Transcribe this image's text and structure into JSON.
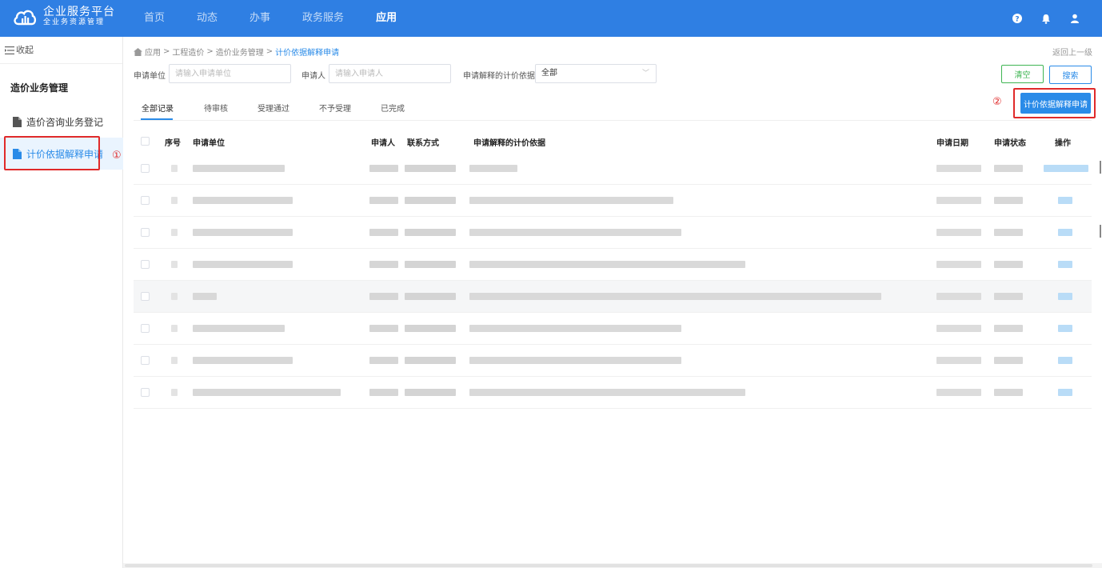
{
  "header": {
    "brand_title": "企业服务平台",
    "brand_subtitle": "全业务资源管理",
    "nav": [
      {
        "label": "首页",
        "active": false
      },
      {
        "label": "动态",
        "active": false
      },
      {
        "label": "办事",
        "active": false
      },
      {
        "label": "政务服务",
        "active": false
      },
      {
        "label": "应用",
        "active": true
      }
    ],
    "icons": [
      "help-icon",
      "bell-icon",
      "user-icon"
    ],
    "color": "#2f7fe3"
  },
  "sidebar": {
    "collapse_label": "收起",
    "section_title": "造价业务管理",
    "items": [
      {
        "label": "造价咨询业务登记",
        "active": false
      },
      {
        "label": "计价依据解释申请",
        "active": true
      }
    ],
    "annotation": "①"
  },
  "breadcrumb": {
    "items": [
      "应用",
      "工程造价",
      "造价业务管理",
      "计价依据解释申请"
    ],
    "separator": ">",
    "back_label": "返回上一级"
  },
  "filters": {
    "unit_label": "申请单位",
    "unit_placeholder": "请输入申请单位",
    "applicant_label": "申请人",
    "applicant_placeholder": "请输入申请人",
    "basis_label": "申请解释的计价依据",
    "basis_value": "全部",
    "clear_label": "清空",
    "search_label": "搜索"
  },
  "tabs": [
    {
      "label": "全部记录",
      "active": true
    },
    {
      "label": "待审核",
      "active": false
    },
    {
      "label": "受理通过",
      "active": false
    },
    {
      "label": "不予受理",
      "active": false
    },
    {
      "label": "已完成",
      "active": false
    }
  ],
  "actions": {
    "apply_label": "计价依据解释申请",
    "annotation": "②"
  },
  "table": {
    "columns": [
      "序号",
      "申请单位",
      "申请人",
      "联系方式",
      "申请解释的计价依据",
      "申请日期",
      "申请状态",
      "操作"
    ],
    "rows": 8,
    "note": "Row contents are pixelated/redacted in the screenshot"
  },
  "colors": {
    "accent": "#2a8be8",
    "highlight": "#e02a2a",
    "success": "#3fb553"
  }
}
